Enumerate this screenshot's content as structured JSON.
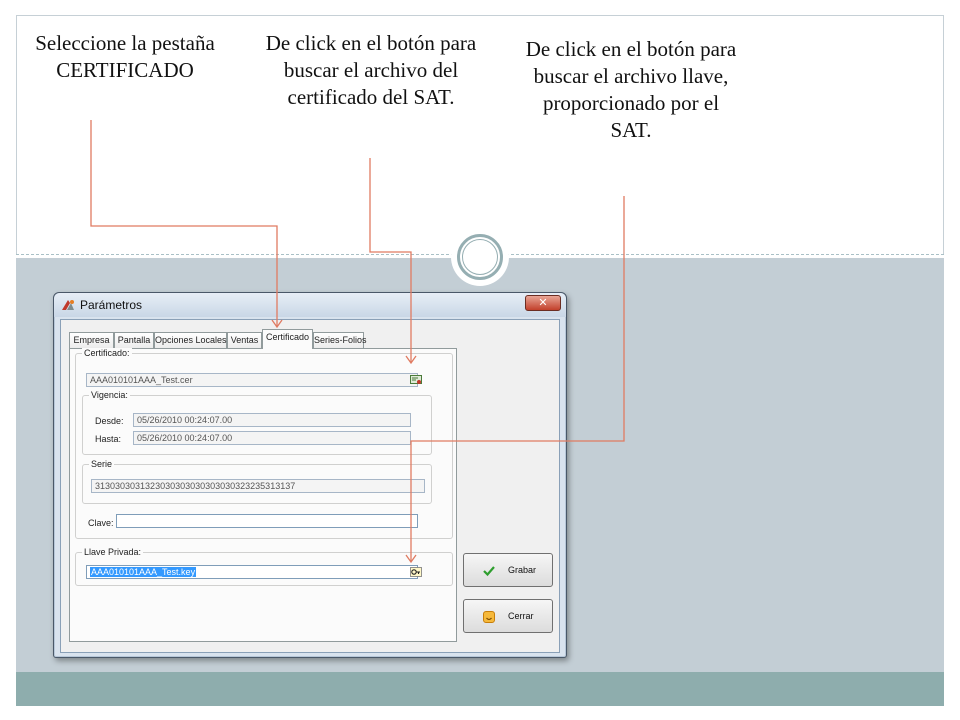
{
  "annotations": {
    "tab": "Seleccione la pestaña CERTIFICADO",
    "cert_button": "De click en el botón para buscar el archivo del certificado del SAT.",
    "key_button": "De click en el botón para buscar el archivo llave, proporcionado por el SAT."
  },
  "window": {
    "title": "Parámetros",
    "close_label": "✕"
  },
  "tabs": [
    {
      "label": "Empresa"
    },
    {
      "label": "Pantalla"
    },
    {
      "label": "Opciones Locales"
    },
    {
      "label": "Ventas"
    },
    {
      "label": "Certificado",
      "active": true
    },
    {
      "label": "Series-Folios"
    }
  ],
  "certificado": {
    "group_label": "Certificado:",
    "file_value": "AAA010101AAA_Test.cer",
    "browse_icon": "certificate-browse-icon",
    "vigencia": {
      "group_label": "Vigencia:",
      "desde_label": "Desde:",
      "desde_value": "05/26/2010 00:24:07.00",
      "hasta_label": "Hasta:",
      "hasta_value": "05/26/2010 00:24:07.00"
    },
    "serie": {
      "group_label": "Serie",
      "value": "3130303031323030303030303030323235313137"
    },
    "clave_label": "Clave:",
    "clave_value": ""
  },
  "llave": {
    "group_label": "Llave Privada:",
    "file_value": "AAA010101AAA_Test.key",
    "browse_icon": "key-browse-icon"
  },
  "buttons": {
    "grabar": "Grabar",
    "cerrar": "Cerrar"
  },
  "colors": {
    "arrow": "#e07b62",
    "selection": "#3399ff",
    "lower_panel": "#c3ced5",
    "footer_bar": "#8eadad"
  }
}
